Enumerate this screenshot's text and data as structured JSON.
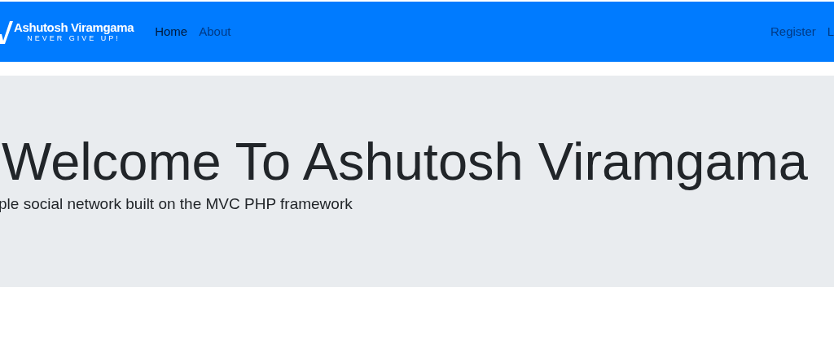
{
  "navbar": {
    "brand": {
      "name": "Ashutosh Viramgama",
      "tagline": "NEVER GIVE UP!"
    },
    "links": [
      {
        "label": "Home",
        "selected": true
      },
      {
        "label": "About",
        "selected": false
      }
    ],
    "right_links": [
      {
        "label": "Register"
      },
      {
        "label": "L"
      }
    ]
  },
  "jumbotron": {
    "heading": "Welcome To Ashutosh Viramgama",
    "lead": "ple social network built on the MVC PHP framework"
  }
}
